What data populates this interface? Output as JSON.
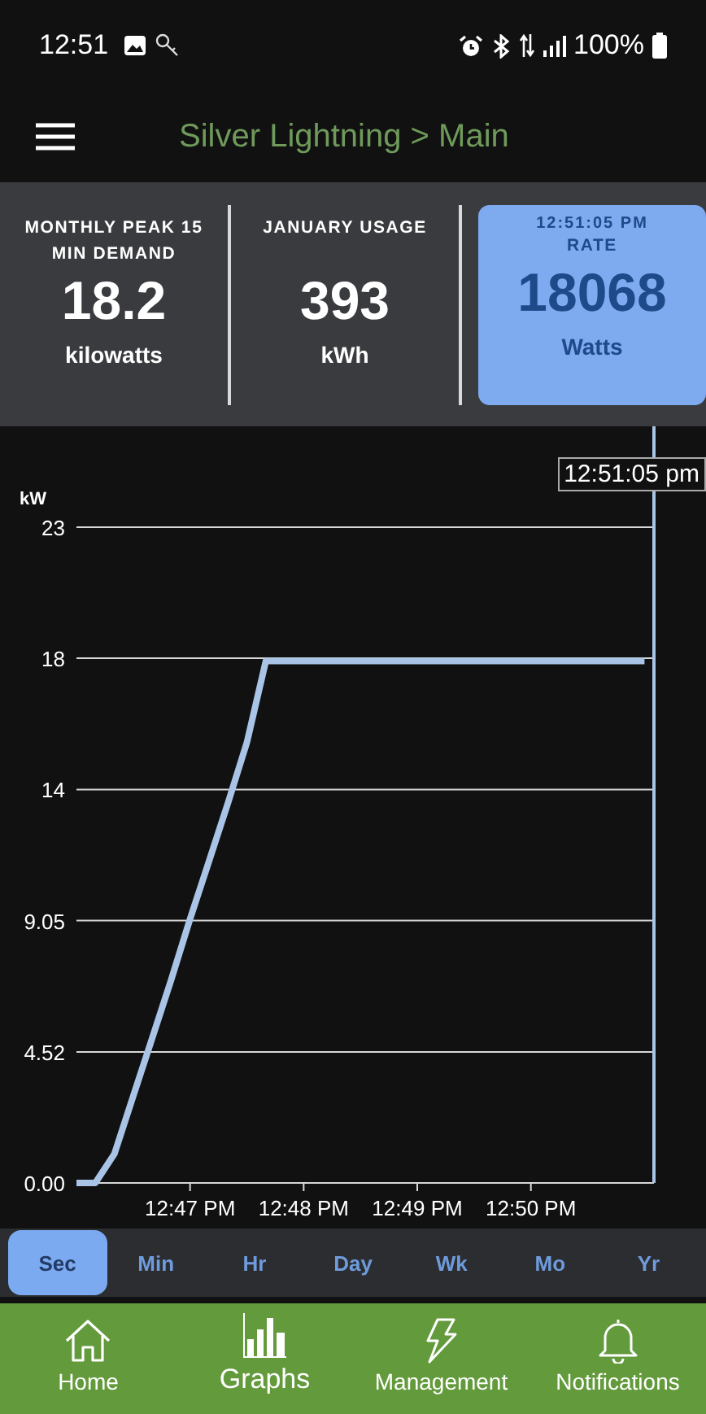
{
  "status_bar": {
    "time": "12:51",
    "battery": "100%"
  },
  "header": {
    "title": "Silver Lightning > Main"
  },
  "stats": [
    {
      "label": "MONTHLY PEAK 15 MIN DEMAND",
      "value": "18.2",
      "unit": "kilowatts",
      "selected": false
    },
    {
      "label": "JANUARY USAGE",
      "value": "393",
      "unit": "kWh",
      "selected": false
    },
    {
      "timestamp": "12:51:05 PM",
      "label": "RATE",
      "value": "18068",
      "unit": "Watts",
      "selected": true
    }
  ],
  "chart": {
    "cursor_label": "12:51:05 pm",
    "chart_data": {
      "type": "line",
      "ylabel": "kW",
      "grid": true,
      "ylim": [
        0,
        22.62
      ],
      "categories": [
        null,
        null,
        null,
        null,
        null,
        null,
        "12:47 PM",
        null,
        null,
        null,
        null,
        null,
        "12:48 PM",
        null,
        null,
        null,
        null,
        null,
        "12:49 PM",
        null,
        null,
        null,
        null,
        null,
        "12:50 PM",
        null,
        null,
        null,
        null,
        null,
        null
      ],
      "yticks": [
        {
          "value": 0,
          "label": "0.00"
        },
        {
          "value": 4.52,
          "label": "4.52"
        },
        {
          "value": 9.05,
          "label": "9.05"
        },
        {
          "value": 13.57,
          "label": "14"
        },
        {
          "value": 18.1,
          "label": "18"
        },
        {
          "value": 22.62,
          "label": "23"
        }
      ],
      "series": [
        {
          "color": "#a9c4e6",
          "values": [
            0,
            0,
            1,
            3,
            5,
            7,
            9.1,
            11.1,
            13.1,
            15.2,
            18,
            18,
            18,
            18,
            18,
            18,
            18,
            18,
            18,
            18,
            18,
            18,
            18,
            18,
            18,
            18,
            18,
            18,
            18,
            18,
            18
          ]
        }
      ]
    }
  },
  "ranges": [
    {
      "label": "Sec",
      "selected": true
    },
    {
      "label": "Min",
      "selected": false
    },
    {
      "label": "Hr",
      "selected": false
    },
    {
      "label": "Day",
      "selected": false
    },
    {
      "label": "Wk",
      "selected": false
    },
    {
      "label": "Mo",
      "selected": false
    },
    {
      "label": "Yr",
      "selected": false
    }
  ],
  "nav": [
    {
      "label": "Home",
      "selected": false
    },
    {
      "label": "Graphs",
      "selected": true
    },
    {
      "label": "Management",
      "selected": false
    },
    {
      "label": "Notifications",
      "selected": false
    }
  ]
}
